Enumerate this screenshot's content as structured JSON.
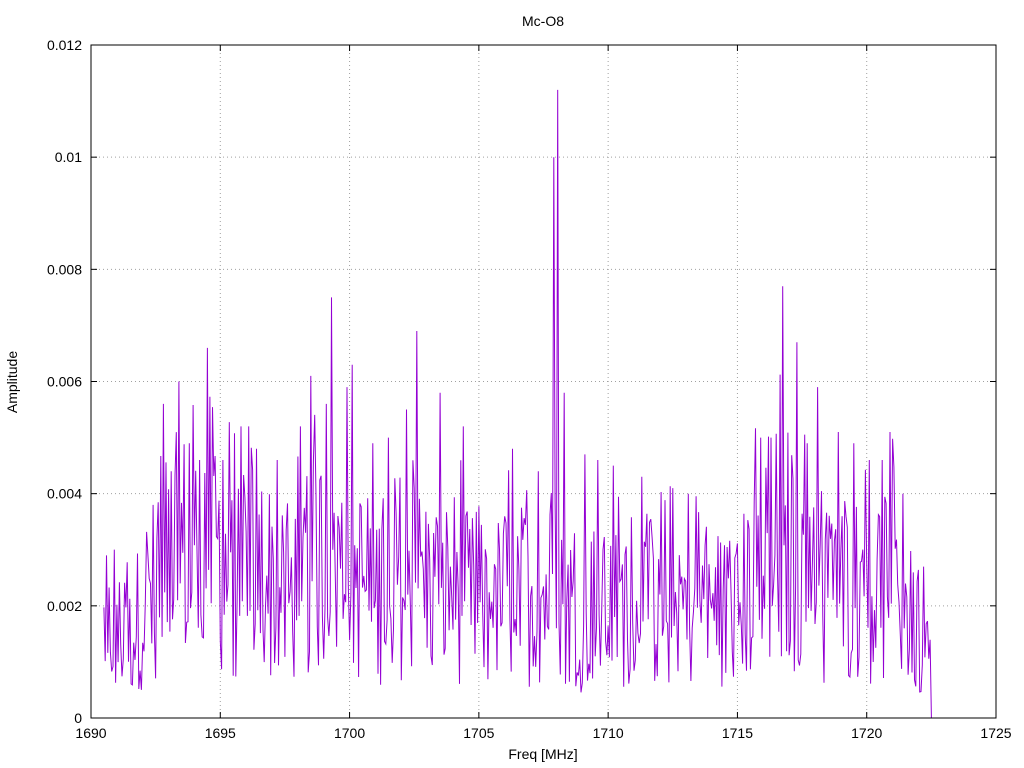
{
  "chart_data": {
    "type": "line",
    "title": "Mc-O8",
    "xlabel": "Freq [MHz]",
    "ylabel": "Amplitude",
    "xlim": [
      1690,
      1725
    ],
    "ylim": [
      0,
      0.012
    ],
    "x_ticks": [
      "1690",
      "1695",
      "1700",
      "1705",
      "1710",
      "1715",
      "1720",
      "1725"
    ],
    "y_ticks": [
      "0",
      "0.002",
      "0.004",
      "0.006",
      "0.008",
      "0.01",
      "0.012"
    ],
    "grid": true,
    "series": [
      {
        "color": "#9400d3",
        "x_start": 1690.5,
        "x_end": 1722.5,
        "x_step": 0.05,
        "envelope": [
          [
            1690.5,
            0.0016
          ],
          [
            1691.0,
            0.0015
          ],
          [
            1691.5,
            0.0014
          ],
          [
            1692.0,
            0.002
          ],
          [
            1692.5,
            0.0026
          ],
          [
            1693.0,
            0.0028
          ],
          [
            1693.5,
            0.003
          ],
          [
            1694.0,
            0.003
          ],
          [
            1694.5,
            0.0034
          ],
          [
            1695.0,
            0.003
          ],
          [
            1695.5,
            0.0024
          ],
          [
            1696.0,
            0.0028
          ],
          [
            1696.5,
            0.0028
          ],
          [
            1697.0,
            0.0024
          ],
          [
            1697.5,
            0.002
          ],
          [
            1698.0,
            0.0024
          ],
          [
            1698.5,
            0.0028
          ],
          [
            1699.0,
            0.0028
          ],
          [
            1699.5,
            0.0028
          ],
          [
            1700.0,
            0.0026
          ],
          [
            1700.5,
            0.0024
          ],
          [
            1701.0,
            0.0022
          ],
          [
            1701.5,
            0.0024
          ],
          [
            1702.0,
            0.0026
          ],
          [
            1702.5,
            0.0026
          ],
          [
            1703.0,
            0.0024
          ],
          [
            1703.5,
            0.0022
          ],
          [
            1704.0,
            0.0024
          ],
          [
            1704.5,
            0.0022
          ],
          [
            1705.0,
            0.002
          ],
          [
            1705.5,
            0.002
          ],
          [
            1706.0,
            0.0022
          ],
          [
            1706.5,
            0.0022
          ],
          [
            1707.0,
            0.0022
          ],
          [
            1707.5,
            0.0022
          ],
          [
            1708.0,
            0.0024
          ],
          [
            1708.5,
            0.002
          ],
          [
            1709.0,
            0.0018
          ],
          [
            1709.5,
            0.002
          ],
          [
            1710.0,
            0.002
          ],
          [
            1710.5,
            0.002
          ],
          [
            1711.0,
            0.002
          ],
          [
            1711.5,
            0.002
          ],
          [
            1712.0,
            0.002
          ],
          [
            1712.5,
            0.002
          ],
          [
            1713.0,
            0.002
          ],
          [
            1713.5,
            0.002
          ],
          [
            1714.0,
            0.0019
          ],
          [
            1714.5,
            0.0019
          ],
          [
            1715.0,
            0.0019
          ],
          [
            1715.5,
            0.0024
          ],
          [
            1716.0,
            0.0028
          ],
          [
            1716.5,
            0.003
          ],
          [
            1717.0,
            0.003
          ],
          [
            1717.5,
            0.0026
          ],
          [
            1718.0,
            0.0026
          ],
          [
            1718.5,
            0.0024
          ],
          [
            1719.0,
            0.0024
          ],
          [
            1719.5,
            0.0024
          ],
          [
            1720.0,
            0.0022
          ],
          [
            1720.5,
            0.0024
          ],
          [
            1721.0,
            0.0024
          ],
          [
            1721.5,
            0.002
          ],
          [
            1722.0,
            0.0014
          ],
          [
            1722.5,
            0.001
          ]
        ],
        "peaks": [
          [
            1690.6,
            0.0029
          ],
          [
            1692.4,
            0.0038
          ],
          [
            1692.8,
            0.0056
          ],
          [
            1693.1,
            0.0044
          ],
          [
            1693.4,
            0.006
          ],
          [
            1693.8,
            0.0049
          ],
          [
            1694.2,
            0.0046
          ],
          [
            1694.5,
            0.0066
          ],
          [
            1695.1,
            0.0046
          ],
          [
            1695.8,
            0.0052
          ],
          [
            1696.1,
            0.0052
          ],
          [
            1696.4,
            0.0048
          ],
          [
            1697.2,
            0.0046
          ],
          [
            1698.1,
            0.0052
          ],
          [
            1698.5,
            0.0061
          ],
          [
            1699.1,
            0.0056
          ],
          [
            1699.3,
            0.0075
          ],
          [
            1699.9,
            0.0059
          ],
          [
            1700.1,
            0.0063
          ],
          [
            1700.9,
            0.0049
          ],
          [
            1701.5,
            0.005
          ],
          [
            1702.2,
            0.0055
          ],
          [
            1702.6,
            0.0069
          ],
          [
            1703.5,
            0.0058
          ],
          [
            1704.4,
            0.0052
          ],
          [
            1706.3,
            0.0048
          ],
          [
            1707.3,
            0.0044
          ],
          [
            1707.9,
            0.01
          ],
          [
            1708.05,
            0.0112
          ],
          [
            1708.3,
            0.0058
          ],
          [
            1709.1,
            0.0047
          ],
          [
            1709.6,
            0.0046
          ],
          [
            1710.2,
            0.0045
          ],
          [
            1711.3,
            0.0043
          ],
          [
            1712.5,
            0.0041
          ],
          [
            1713.1,
            0.004
          ],
          [
            1715.9,
            0.005
          ],
          [
            1716.3,
            0.005
          ],
          [
            1716.75,
            0.0077
          ],
          [
            1717.3,
            0.0067
          ],
          [
            1717.7,
            0.0049
          ],
          [
            1718.1,
            0.0059
          ],
          [
            1718.9,
            0.0051
          ],
          [
            1719.5,
            0.0049
          ],
          [
            1720.1,
            0.0046
          ],
          [
            1720.6,
            0.0046
          ],
          [
            1720.9,
            0.0051
          ],
          [
            1721.4,
            0.004
          ],
          [
            1722.2,
            0.0027
          ]
        ]
      }
    ]
  }
}
